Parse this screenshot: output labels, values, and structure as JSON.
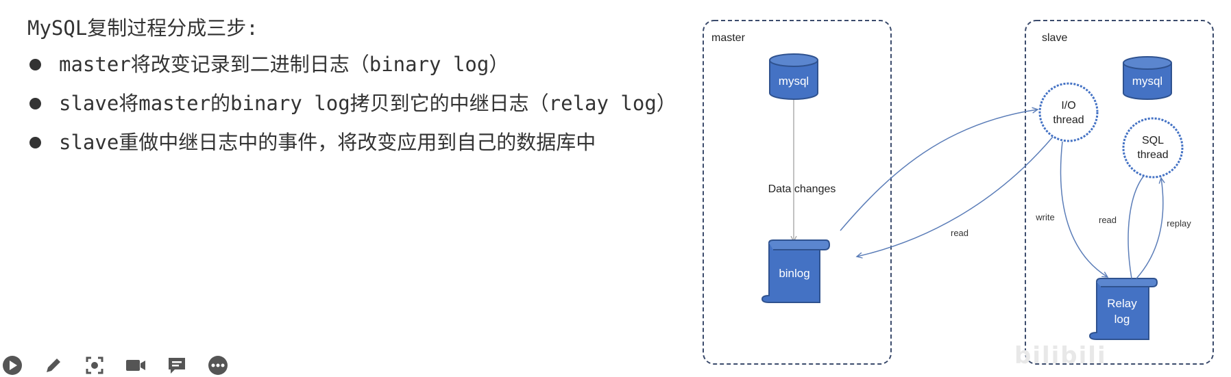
{
  "slide": {
    "heading": "MySQL复制过程分成三步:",
    "bullets": [
      "master将改变记录到二进制日志（binary log）",
      "slave将master的binary log拷贝到它的中继日志（relay log）",
      "slave重做中继日志中的事件，将改变应用到自己的数据库中"
    ]
  },
  "diagram": {
    "master_label": "master",
    "slave_label": "slave",
    "master_db": "mysql",
    "slave_db": "mysql",
    "binlog": "binlog",
    "relay_log": [
      "Relay",
      "log"
    ],
    "io_thread": [
      "I/O",
      "thread"
    ],
    "sql_thread": [
      "SQL",
      "thread"
    ],
    "edges": {
      "data_changes": "Data changes",
      "read_binlog": "read",
      "write": "write",
      "read_relay": "read",
      "replay": "replay"
    },
    "colors": {
      "node_fill": "#4472c4",
      "node_stroke": "#2f528f",
      "dash_border": "#3a4a6b",
      "arrow": "#5b7db8"
    }
  },
  "toolbar": {
    "buttons": [
      "play-icon",
      "pencil-icon",
      "screenshot-icon",
      "camera-icon",
      "comment-icon",
      "more-icon"
    ]
  },
  "watermark": "bilibili"
}
